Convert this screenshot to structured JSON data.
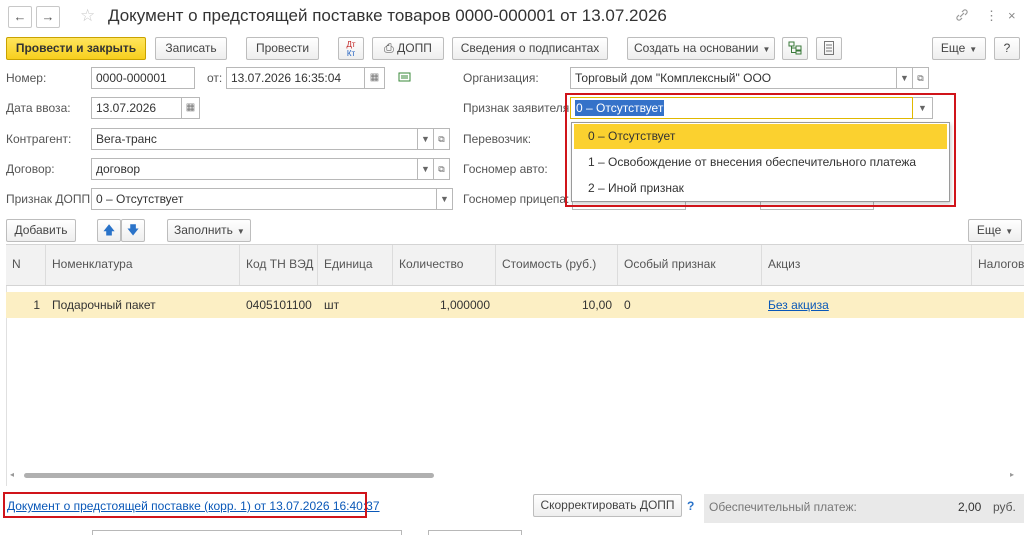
{
  "window": {
    "title": "Документ о предстоящей поставке товаров 0000-000001 от 13.07.2026",
    "back_icon": "←",
    "forward_icon": "→",
    "star_icon": "☆",
    "link_icon": "🔗",
    "more_icon": "⋮",
    "close_icon": "×"
  },
  "toolbar": {
    "post_and_close": "Провести и закрыть",
    "write": "Записать",
    "post": "Провести",
    "dt_kt": "Дт Кт",
    "dopp_print": "ДОПП",
    "signers": "Сведения о подписантах",
    "create_based": "Создать на основании",
    "more": "Еще",
    "help": "?"
  },
  "form": {
    "number_label": "Номер:",
    "number_value": "0000-000001",
    "from_label": "от:",
    "from_value": "13.07.2026 16:35:04",
    "import_date_label": "Дата ввоза:",
    "import_date_value": "13.07.2026",
    "counterparty_label": "Контрагент:",
    "counterparty_value": "Вега-транс",
    "contract_label": "Договор:",
    "contract_value": "договор",
    "dopp_sign_label": "Признак ДОПП:",
    "dopp_sign_value": "0 – Отсутствует",
    "organization_label": "Организация:",
    "organization_value": "Торговый дом \"Комплексный\" ООО",
    "applicant_label": "Признак заявителя:",
    "applicant_value": "0 – Отсутствует",
    "carrier_label": "Перевозчик:",
    "auto_number_label": "Госномер авто:",
    "trailer_number_label": "Госномер прицепа:"
  },
  "dropdown": {
    "options": [
      "0 – Отсутствует",
      "1 – Освобождение от внесения обеспечительного платежа",
      "2 – Иной признак"
    ]
  },
  "table_toolbar": {
    "add": "Добавить",
    "fill": "Заполнить",
    "more": "Еще"
  },
  "table": {
    "headers": [
      "N",
      "Номенклатура",
      "Код ТН ВЭД",
      "Единица",
      "Количество",
      "Стоимость (руб.)",
      "Особый признак",
      "Акциз",
      "Налогов"
    ],
    "rows": [
      [
        "1",
        "Подарочный пакет",
        "0405101100",
        "шт",
        "1,000000",
        "10,00",
        "0",
        "Без акциза",
        ""
      ]
    ]
  },
  "footer": {
    "link": "Документ о предстоящей поставке (корр. 1) от 13.07.2026 16:40:37",
    "correct_button": "Скорректировать ДОПП",
    "help": "?",
    "deposit_label": "Обеспечительный платеж:",
    "deposit_value": "2,00",
    "deposit_unit": "руб."
  },
  "colors": {
    "primary": "#f7cf1d",
    "selected_row": "#fcefc4",
    "highlight_box": "#d0141a",
    "link": "#0a58b8"
  }
}
